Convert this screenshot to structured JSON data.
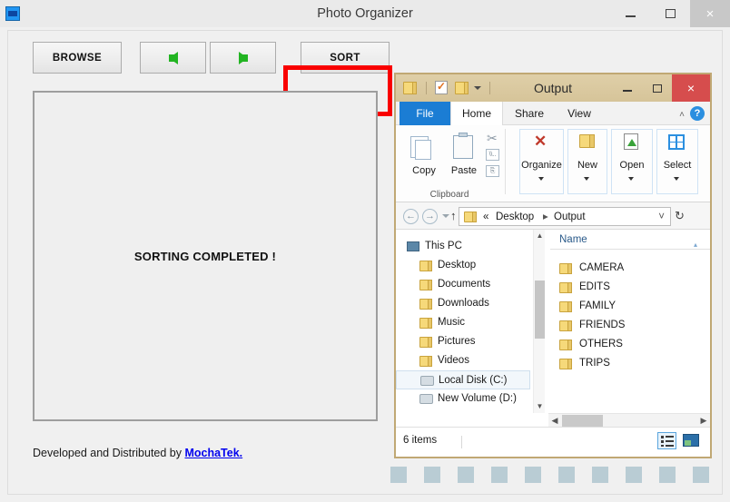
{
  "app": {
    "title": "Photo Organizer",
    "icon": "app-icon",
    "window_controls": {
      "minimize": "minimize",
      "maximize": "maximize",
      "close": "×"
    },
    "toolbar": {
      "browse_label": "BROWSE",
      "prev_label": "previous-arrow",
      "next_label": "next-arrow",
      "sort_label": "SORT",
      "highlight_color": "#f90000"
    },
    "display": {
      "message": "SORTING COMPLETED !"
    },
    "footer": {
      "text": "Developed and Distributed by ",
      "link_label": "MochaTek.",
      "link_color": "#0000ee"
    },
    "progress": {
      "count": 10,
      "square_color": "#b9ccd4"
    }
  },
  "explorer": {
    "title": "Output",
    "quick_access": [
      "folder-icon",
      "document-check-icon",
      "folder-icon",
      "dropdown-caret"
    ],
    "window_controls": {
      "minimize": "minimize",
      "maximize": "maximize",
      "close": "×"
    },
    "tabs": [
      {
        "label": "File",
        "active": false,
        "is_file_menu": true
      },
      {
        "label": "Home",
        "active": true,
        "is_file_menu": false
      },
      {
        "label": "Share",
        "active": false,
        "is_file_menu": false
      },
      {
        "label": "View",
        "active": false,
        "is_file_menu": false
      }
    ],
    "help_label": "?",
    "collapse_label": "˄",
    "ribbon": {
      "clipboard_group_label": "Clipboard",
      "items": [
        {
          "label": "Copy",
          "icon": "copy-icon"
        },
        {
          "label": "Paste",
          "icon": "paste-icon"
        },
        {
          "label": "Organize",
          "icon": "delete-x-icon",
          "has_dropdown": true
        },
        {
          "label": "New",
          "icon": "new-folder-icon",
          "has_dropdown": true
        },
        {
          "label": "Open",
          "icon": "open-icon",
          "has_dropdown": true
        },
        {
          "label": "Select",
          "icon": "select-grid-icon",
          "has_dropdown": true
        }
      ],
      "small_icons": [
        "cut-scissors-icon",
        "copy-path-icon",
        "paste-shortcut-icon"
      ]
    },
    "address_bar": {
      "back_label": "←",
      "forward_label": "→",
      "recent_label": "▾",
      "up_label": "↑",
      "path_prefix": "«",
      "path_segments": [
        "Desktop",
        "Output"
      ],
      "dropdown_label": "˅",
      "refresh_label": "↻"
    },
    "tree": {
      "items": [
        {
          "label": "This PC",
          "icon": "this-pc-icon",
          "indent": 0,
          "selected": false
        },
        {
          "label": "Desktop",
          "icon": "folder-icon",
          "indent": 1,
          "selected": false
        },
        {
          "label": "Documents",
          "icon": "folder-icon",
          "indent": 1,
          "selected": false
        },
        {
          "label": "Downloads",
          "icon": "folder-icon",
          "indent": 1,
          "selected": false
        },
        {
          "label": "Music",
          "icon": "folder-icon",
          "indent": 1,
          "selected": false
        },
        {
          "label": "Pictures",
          "icon": "folder-icon",
          "indent": 1,
          "selected": false
        },
        {
          "label": "Videos",
          "icon": "folder-icon",
          "indent": 1,
          "selected": false
        },
        {
          "label": "Local Disk (C:)",
          "icon": "disk-icon",
          "indent": 1,
          "selected": true
        },
        {
          "label": "New Volume (D:)",
          "icon": "disk-icon",
          "indent": 1,
          "selected": false
        }
      ]
    },
    "file_list": {
      "column_header": "Name",
      "sort_indicator": "▴",
      "items": [
        {
          "label": "CAMERA",
          "icon": "folder-icon"
        },
        {
          "label": "EDITS",
          "icon": "folder-icon"
        },
        {
          "label": "FAMILY",
          "icon": "folder-icon"
        },
        {
          "label": "FRIENDS",
          "icon": "folder-icon"
        },
        {
          "label": "OTHERS",
          "icon": "folder-icon"
        },
        {
          "label": "TRIPS",
          "icon": "folder-icon"
        }
      ]
    },
    "status_bar": {
      "item_count": "6 items",
      "view_details_label": "details-view",
      "view_large_label": "large-icons-view"
    }
  }
}
